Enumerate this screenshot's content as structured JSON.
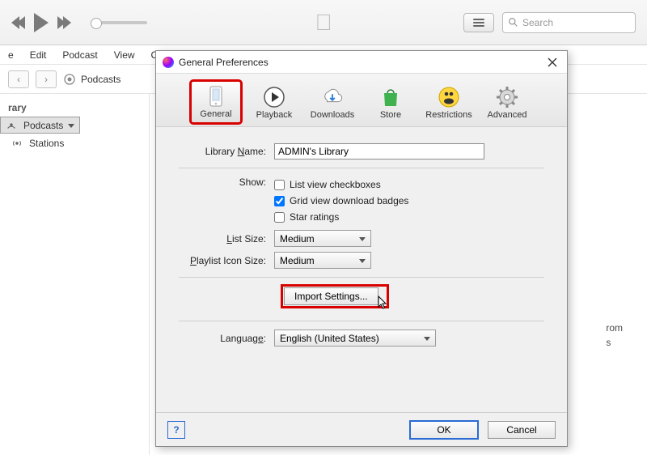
{
  "topbar": {
    "search_placeholder": "Search"
  },
  "menubar": {
    "items": [
      "e",
      "Edit",
      "Podcast",
      "View",
      "Co"
    ]
  },
  "toolbar2": {
    "section_label": "Podcasts"
  },
  "sidebar": {
    "header": "rary",
    "items": [
      {
        "label": "Podcasts"
      },
      {
        "label": "Stations"
      }
    ]
  },
  "partial": {
    "line1": "rom",
    "line2": "s"
  },
  "dialog": {
    "title": "General Preferences",
    "tabs": [
      {
        "label": "General"
      },
      {
        "label": "Playback"
      },
      {
        "label": "Downloads"
      },
      {
        "label": "Store"
      },
      {
        "label": "Restrictions"
      },
      {
        "label": "Advanced"
      }
    ],
    "library_name_label": "Library Name:",
    "library_name_value": "ADMIN's Library",
    "show_label": "Show:",
    "show_checks": {
      "list_view": "List view checkboxes",
      "grid_view": "Grid view download badges",
      "star": "Star ratings"
    },
    "list_size_label": "List Size:",
    "list_size_value": "Medium",
    "playlist_size_label": "Playlist Icon Size:",
    "playlist_size_value": "Medium",
    "import_button": "Import Settings...",
    "language_label": "Language:",
    "language_value": "English (United States)",
    "help": "?",
    "ok": "OK",
    "cancel": "Cancel"
  }
}
